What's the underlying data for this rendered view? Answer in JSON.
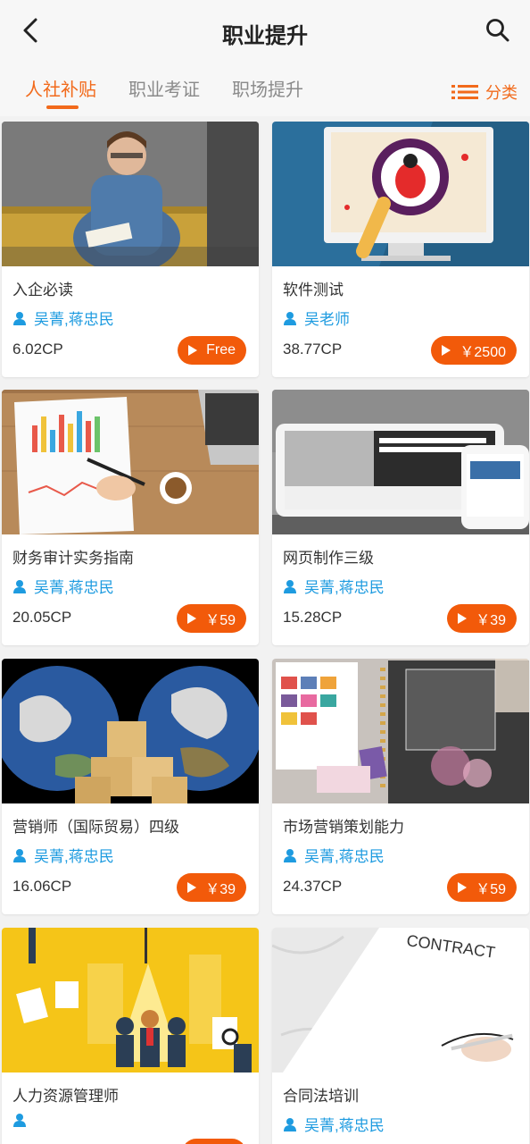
{
  "header": {
    "title": "职业提升"
  },
  "tabs": [
    {
      "label": "人社补贴",
      "active": true
    },
    {
      "label": "职业考证",
      "active": false
    },
    {
      "label": "职场提升",
      "active": false
    }
  ],
  "category": {
    "label": "分类"
  },
  "colors": {
    "accent": "#f26a1b",
    "price_button": "#f25a0a",
    "teacher_text": "#1e9be0"
  },
  "courses": [
    {
      "title": "入企必读",
      "teacher": "吴菁,蒋忠民",
      "points": "6.02CP",
      "price": "Free"
    },
    {
      "title": "软件测试",
      "teacher": "吴老师",
      "points": "38.77CP",
      "price": "￥2500"
    },
    {
      "title": "财务审计实务指南",
      "teacher": "吴菁,蒋忠民",
      "points": "20.05CP",
      "price": "￥59"
    },
    {
      "title": "网页制作三级",
      "teacher": "吴菁,蒋忠民",
      "points": "15.28CP",
      "price": "￥39"
    },
    {
      "title": "营销师（国际贸易）四级",
      "teacher": "吴菁,蒋忠民",
      "points": "16.06CP",
      "price": "￥39"
    },
    {
      "title": "市场营销策划能力",
      "teacher": "吴菁,蒋忠民",
      "points": "24.37CP",
      "price": "￥59"
    },
    {
      "title": "人力资源管理师",
      "teacher": "",
      "points": "",
      "price": ""
    },
    {
      "title": "合同法培训",
      "teacher": "吴菁,蒋忠民",
      "points": "",
      "price": ""
    }
  ],
  "thumbnail_contract_text": "CONTRACT"
}
